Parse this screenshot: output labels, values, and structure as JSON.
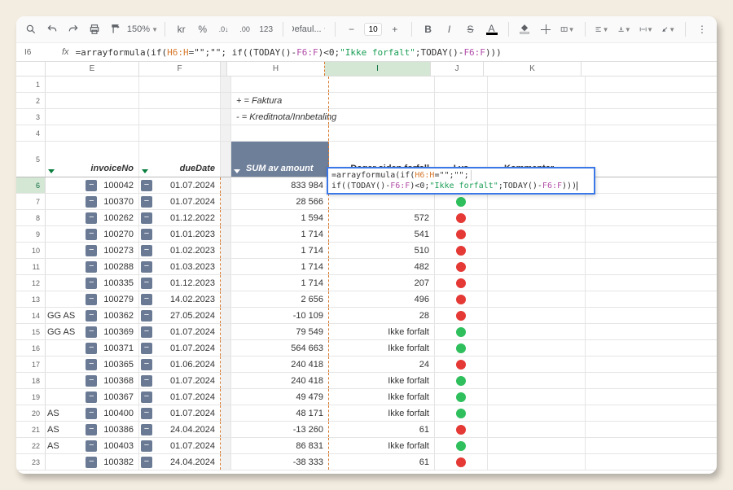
{
  "toolbar": {
    "zoom": "150%",
    "currency": "kr",
    "percent": "%",
    "dec_dec": ".0",
    "dec_inc": ".00",
    "num123": "123",
    "font": "Defaul...",
    "font_size": "10",
    "bold": "B",
    "italic": "I",
    "strike": "S",
    "text_color": "A"
  },
  "formula_bar": {
    "cell_ref": "I6",
    "fx": "fx",
    "prefix": "=arrayformula(if(",
    "ref_h": "H6:H",
    "mid1": "=\"\";\"\"; if((TODAY()-",
    "ref_f1": "F6:F",
    "mid2": ")<0;",
    "str1": "\"Ikke forfalt\"",
    "mid3": ";TODAY()-",
    "ref_f2": "F6:F",
    "suffix": ")))"
  },
  "columns": [
    "E",
    "F",
    "H",
    "I",
    "J",
    "K"
  ],
  "notes": {
    "faktura": "+ = Faktura",
    "kreditnota": "- = Kreditnota/Innbetaling"
  },
  "headers": {
    "invoiceNo": "invoiceNo",
    "dueDate": "dueDate",
    "sumAmount": "SUM av amount",
    "days": "Dager siden forfall",
    "light": "Lys",
    "comment": "Kommentar"
  },
  "selected_cell": "I6",
  "overlay": {
    "line1_a": "=arrayformula(if(",
    "line1_ref": "H6:H",
    "line1_b": "=\"\";\"\";",
    "line2_a": "if((TODAY()-",
    "line2_ref1": "F6:F",
    "line2_b": ")<0;",
    "line2_str": "\"Ikke forfalt\"",
    "line2_c": ";TODAY()-",
    "line2_ref2": "F6:F",
    "line2_d": ")))"
  },
  "rows": [
    {
      "rn": 6,
      "inv": "100042",
      "due": "01.07.2024",
      "amt": "833 984",
      "days": "",
      "dot": "",
      "pre": ""
    },
    {
      "rn": 7,
      "inv": "100370",
      "due": "01.07.2024",
      "amt": "28 566",
      "days": "",
      "dot": "green",
      "pre": ""
    },
    {
      "rn": 8,
      "inv": "100262",
      "due": "01.12.2022",
      "amt": "1 594",
      "days": "572",
      "dot": "red",
      "pre": ""
    },
    {
      "rn": 9,
      "inv": "100270",
      "due": "01.01.2023",
      "amt": "1 714",
      "days": "541",
      "dot": "red",
      "pre": ""
    },
    {
      "rn": 10,
      "inv": "100273",
      "due": "01.02.2023",
      "amt": "1 714",
      "days": "510",
      "dot": "red",
      "pre": ""
    },
    {
      "rn": 11,
      "inv": "100288",
      "due": "01.03.2023",
      "amt": "1 714",
      "days": "482",
      "dot": "red",
      "pre": ""
    },
    {
      "rn": 12,
      "inv": "100335",
      "due": "01.12.2023",
      "amt": "1 714",
      "days": "207",
      "dot": "red",
      "pre": ""
    },
    {
      "rn": 13,
      "inv": "100279",
      "due": "14.02.2023",
      "amt": "2 656",
      "days": "496",
      "dot": "red",
      "pre": ""
    },
    {
      "rn": 14,
      "inv": "100362",
      "due": "27.05.2024",
      "amt": "-10 109",
      "days": "28",
      "dot": "red",
      "pre": "GG AS"
    },
    {
      "rn": 15,
      "inv": "100369",
      "due": "01.07.2024",
      "amt": "79 549",
      "days": "Ikke forfalt",
      "dot": "green",
      "pre": "GG AS"
    },
    {
      "rn": 16,
      "inv": "100371",
      "due": "01.07.2024",
      "amt": "564 663",
      "days": "Ikke forfalt",
      "dot": "green",
      "pre": ""
    },
    {
      "rn": 17,
      "inv": "100365",
      "due": "01.06.2024",
      "amt": "240 418",
      "days": "24",
      "dot": "red",
      "pre": ""
    },
    {
      "rn": 18,
      "inv": "100368",
      "due": "01.07.2024",
      "amt": "240 418",
      "days": "Ikke forfalt",
      "dot": "green",
      "pre": ""
    },
    {
      "rn": 19,
      "inv": "100367",
      "due": "01.07.2024",
      "amt": "49 479",
      "days": "Ikke forfalt",
      "dot": "green",
      "pre": ""
    },
    {
      "rn": 20,
      "inv": "100400",
      "due": "01.07.2024",
      "amt": "48 171",
      "days": "Ikke forfalt",
      "dot": "green",
      "pre": "AS"
    },
    {
      "rn": 21,
      "inv": "100386",
      "due": "24.04.2024",
      "amt": "-13 260",
      "days": "61",
      "dot": "red",
      "pre": "AS"
    },
    {
      "rn": 22,
      "inv": "100403",
      "due": "01.07.2024",
      "amt": "86 831",
      "days": "Ikke forfalt",
      "dot": "green",
      "pre": "AS"
    },
    {
      "rn": 23,
      "inv": "100382",
      "due": "24.04.2024",
      "amt": "-38 333",
      "days": "61",
      "dot": "red",
      "pre": ""
    }
  ]
}
